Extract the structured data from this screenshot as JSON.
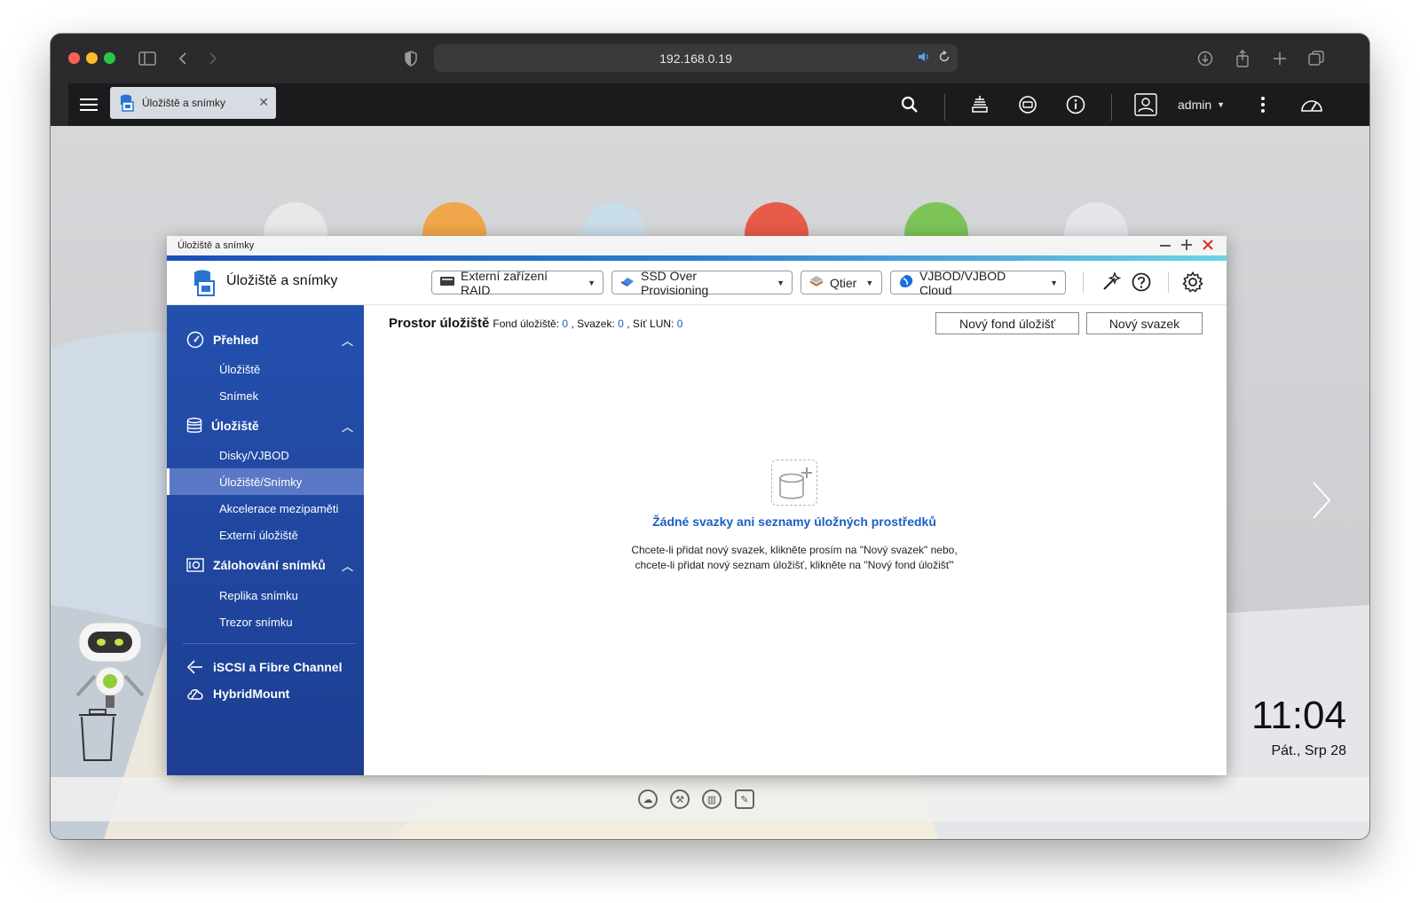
{
  "browser": {
    "url": "192.168.0.19"
  },
  "qts": {
    "tab_title": "Úložiště a snímky",
    "user": "admin"
  },
  "window": {
    "title": "Úložiště a snímky",
    "app_title": "Úložiště a snímky",
    "dropdowns": [
      {
        "label": "Externí zařízení RAID"
      },
      {
        "label": "SSD Over Provisioning"
      },
      {
        "label": "Qtier"
      },
      {
        "label": "VJBOD/VJBOD Cloud"
      }
    ]
  },
  "sidebar": {
    "sections": [
      {
        "label": "Přehled",
        "items": [
          "Úložiště",
          "Snímek"
        ]
      },
      {
        "label": "Úložiště",
        "items": [
          "Disky/VJBOD",
          "Úložiště/Snímky",
          "Akcelerace mezipaměti",
          "Externí úložiště"
        ]
      },
      {
        "label": "Zálohování snímků",
        "items": [
          "Replika snímku",
          "Trezor snímku"
        ]
      }
    ],
    "active_item": "Úložiště/Snímky",
    "bottom_items": [
      "iSCSI a Fibre Channel",
      "HybridMount"
    ]
  },
  "content": {
    "title": "Prostor úložiště",
    "stats": {
      "pool_label": "Fond úložiště:",
      "pool_count": "0",
      "volume_label": ", Svazek:",
      "volume_count": "0",
      "lun_label": ", Síť LUN:",
      "lun_count": "0"
    },
    "new_pool_button": "Nový fond úložišť",
    "new_volume_button": "Nový svazek",
    "empty_title": "Žádné svazky ani seznamy úložných prostředků",
    "empty_line1": "Chcete-li přidat nový svazek, klikněte prosím na \"Nový svazek\" nebo,",
    "empty_line2": "chcete-li přidat nový seznam úložišť, klikněte na \"Nový fond úložišť\""
  },
  "desktop": {
    "time": "11:04",
    "date": "Pát., Srp 28"
  },
  "icons": {
    "storage_app_icon": "storage-app-icon",
    "accent": "#1a5fc4",
    "sidebar_bg": "#2450ae"
  }
}
